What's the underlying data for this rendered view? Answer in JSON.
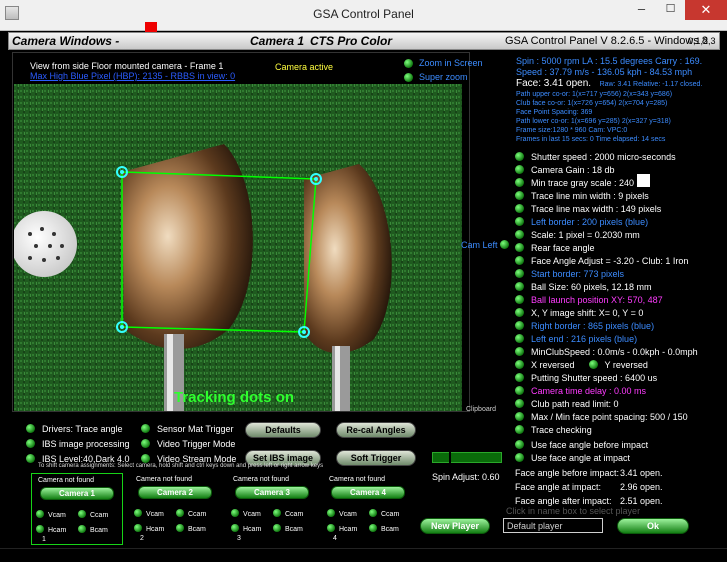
{
  "window": {
    "title": "GSA Control Panel"
  },
  "header": {
    "camera_windows": "Camera Windows -",
    "camera_label": "Camera 1",
    "camera_model": "CTS Pro Color",
    "version": "GSA Control Panel V 8.2.6.5 - Windows 8",
    "camera_numbers": "0,1,2,3"
  },
  "camera_view": {
    "view_title": "View from side Floor mounted camera -  Frame 1",
    "view_subtitle": "Max High Blue Pixel (HBP): 2135 - RBBS in view: 0",
    "status": "Camera active",
    "zoom_label": "Zoom in Screen",
    "super_zoom_label": "Super zoom",
    "overlay_text": "Tracking dots on",
    "clipboard": "Clipboard",
    "cam_left": "Cam Left"
  },
  "stats": {
    "line1": "Spin : 5000 rpm  LA : 15.5 degrees  Carry : 169.",
    "line2": "Speed : 37.79 m/s - 136.05 kph - 84.53 mph",
    "face_label": "Face: 3.41 open.",
    "face_raw": "Raw: 3.41 Relative: -1.17 closed.",
    "small": [
      "Path upper co-or: 1(x=717 y=656) 2(x=343 y=686)",
      "Club face co-or: 1(x=726 y=654) 2(x=704 y=285)",
      "Face Point Spacing: 369",
      "Path lower co-or: 1(x=696 y=285) 2(x=327 y=318)",
      "Frame size:1280 * 960 Cam: VPC:0",
      "Frames in last 15 secs: 0 Time elapsed: 14 secs"
    ]
  },
  "options": [
    {
      "text": "Shutter speed : 2000 micro-seconds",
      "color": "white"
    },
    {
      "text": "Camera Gain : 18 db",
      "color": "white"
    },
    {
      "text": "Min trace gray scale : 240",
      "color": "white"
    },
    {
      "text": "Trace line min width : 9 pixels",
      "color": "white"
    },
    {
      "text": "Trace line max width : 149 pixels",
      "color": "white"
    },
    {
      "text": "Left border : 200 pixels (blue)",
      "color": "blue"
    },
    {
      "text": "Scale: 1 pixel = 0.2030 mm",
      "color": "white"
    },
    {
      "text": "Rear face angle",
      "color": "white"
    },
    {
      "text": "Face Angle Adjust = -3.20 - Club: 1 Iron",
      "color": "white"
    },
    {
      "text": "Start border: 773 pixels",
      "color": "blue"
    },
    {
      "text": "Ball Size: 60 pixels, 12.18 mm",
      "color": "white"
    },
    {
      "text": "Ball launch position XY: 570, 487",
      "color": "magenta"
    },
    {
      "text": "X, Y image shift: X= 0, Y = 0",
      "color": "white"
    },
    {
      "text": "Right border : 865 pixels (blue)",
      "color": "blue"
    },
    {
      "text": "Left end : 216 pixels (blue)",
      "color": "blue"
    },
    {
      "text": "MinClubSpeed : 0.0m/s - 0.0kph - 0.0mph",
      "color": "white"
    },
    {
      "text": "X reversed",
      "color": "white",
      "extra": "Y reversed"
    },
    {
      "text": "Putting Shutter speed : 6400 us",
      "color": "white"
    },
    {
      "text": "Camera time delay : 0.00 ms",
      "color": "magenta"
    },
    {
      "text": "Club path read limit: 0",
      "color": "white"
    },
    {
      "text": "Max / Min face point spacing: 500 / 150",
      "color": "white"
    },
    {
      "text": "Trace checking",
      "color": "white"
    },
    {
      "text": "Use face angle before impact",
      "color": "white"
    },
    {
      "text": "Use face angle at impact",
      "color": "white"
    }
  ],
  "face_angles": [
    {
      "label": "Face angle before impact:",
      "value": "3.41 open."
    },
    {
      "label": "Face angle at impact:",
      "value": "2.96 open."
    },
    {
      "label": "Face angle after impact:",
      "value": "2.51 open."
    }
  ],
  "controls": {
    "drivers_trace": "Drivers: Trace angle",
    "sensor_mat": "Sensor Mat Trigger",
    "ibs_processing": "IBS image processing",
    "video_trigger": "Video Trigger Mode",
    "ibs_level": "IBS Level:40,Dark 4.0",
    "video_stream": "Video Stream Mode",
    "defaults_btn": "Defaults",
    "recal_btn": "Re-cal Angles",
    "set_ibs_btn": "Set IBS image",
    "soft_trigger_btn": "Soft Trigger",
    "shift_note": "To shift camera assignments: Select camera, hold shift and ctrl keys down and press left or right arrow keys",
    "spin_adjust": "Spin Adjust: 0.60",
    "new_player_btn": "New Player",
    "click_hint": "Click in name box to select player",
    "player_name": "Default player",
    "ok_btn": "Ok"
  },
  "cameras": [
    {
      "status": "Camera not found",
      "button": "Camera 1",
      "vcam": "Vcam",
      "ccam": "Ccam",
      "hcam": "Hcam",
      "bcam": "Bcam",
      "num": "1"
    },
    {
      "status": "Camera not found",
      "button": "Camera 2",
      "vcam": "Vcam",
      "ccam": "Ccam",
      "hcam": "Hcam",
      "bcam": "Bcam",
      "num": "2"
    },
    {
      "status": "Camera not found",
      "button": "Camera 3",
      "vcam": "Vcam",
      "ccam": "Ccam",
      "hcam": "Hcam",
      "bcam": "Bcam",
      "num": "3"
    },
    {
      "status": "Camera not found",
      "button": "Camera 4",
      "vcam": "Vcam",
      "ccam": "Ccam",
      "hcam": "Hcam",
      "bcam": "Bcam",
      "num": "4"
    }
  ]
}
